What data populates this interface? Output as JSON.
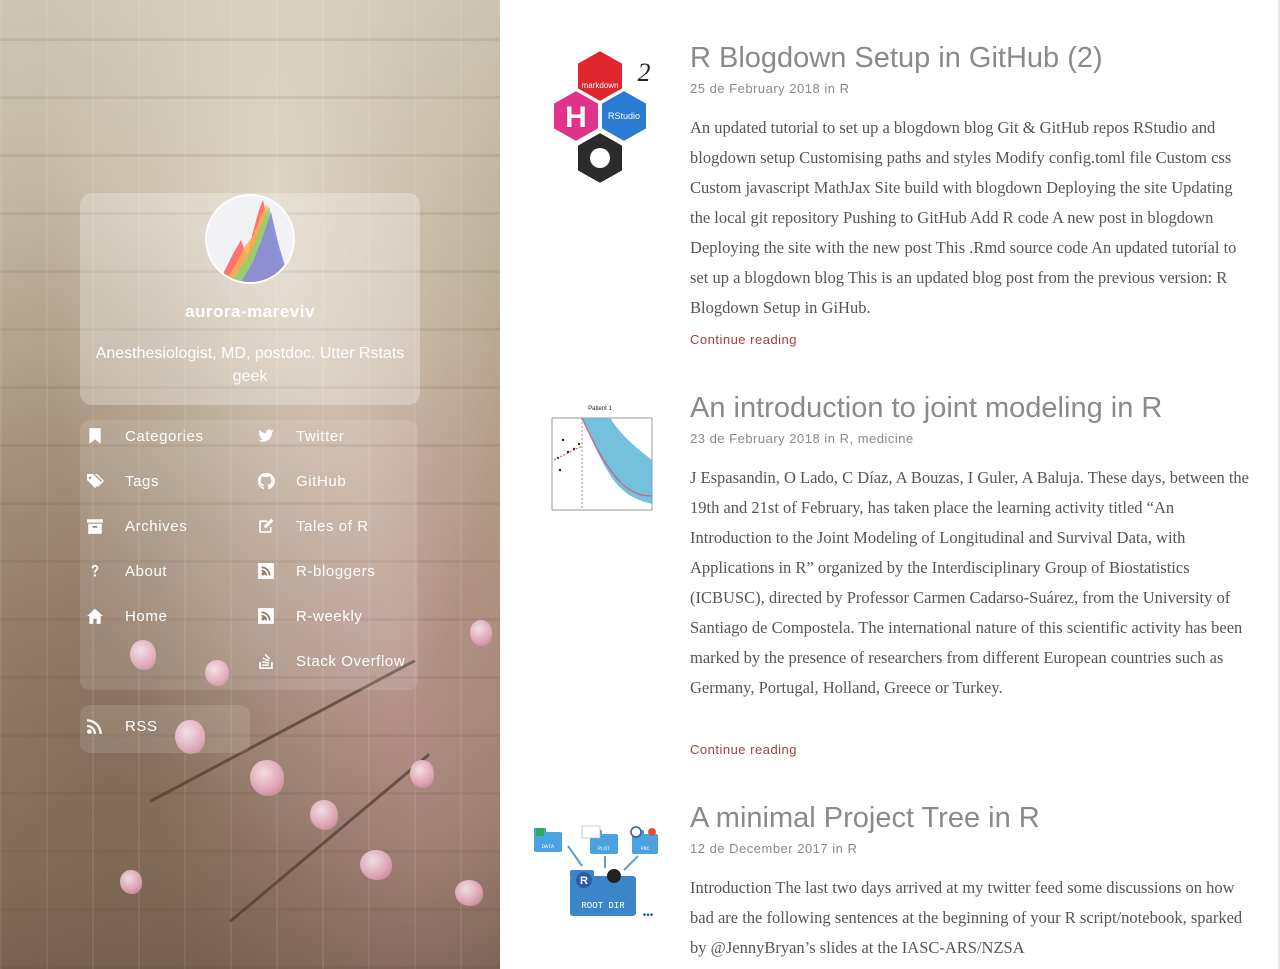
{
  "sidebar": {
    "site_name": "aurora-mareviv",
    "description": "Anesthesiologist, MD, postdoc. Utter Rstats geek",
    "menu_left": [
      {
        "label": "Categories",
        "icon": "bookmark-icon"
      },
      {
        "label": "Tags",
        "icon": "tags-icon"
      },
      {
        "label": "Archives",
        "icon": "archive-icon"
      },
      {
        "label": "About",
        "icon": "question-icon"
      },
      {
        "label": "Home",
        "icon": "home-icon"
      }
    ],
    "menu_right": [
      {
        "label": "Twitter",
        "icon": "twitter-icon"
      },
      {
        "label": "GitHub",
        "icon": "github-icon"
      },
      {
        "label": "Tales of R",
        "icon": "edit-icon"
      },
      {
        "label": "R-bloggers",
        "icon": "rss-square-icon"
      },
      {
        "label": "R-weekly",
        "icon": "rss-square-icon"
      },
      {
        "label": "Stack Overflow",
        "icon": "stack-overflow-icon"
      }
    ],
    "rss": {
      "label": "RSS",
      "icon": "rss-icon"
    }
  },
  "posts": [
    {
      "title": "R Blogdown Setup in GitHub (2)",
      "date": "25 de February 2018",
      "in_word": "in",
      "categories": [
        "R"
      ],
      "summary": "An updated tutorial to set up a blogdown blog Git & GitHub repos RStudio and blogdown setup Customising paths and styles Modify config.toml file Custom css Custom javascript MathJax Site build with blogdown Deploying the site Updating the local git repository Pushing to GitHub Add R code A new post in blogdown Deploying the site with the new post This .Rmd source code An updated tutorial to set up a blogdown blog This is an updated blog post from the previous version: R Blogdown Setup in GiHub.",
      "continue_label": "Continue reading",
      "thumb": {
        "badge_number": "2",
        "labels": [
          "markdown",
          "H",
          "RStudio"
        ]
      }
    },
    {
      "title": "An introduction to joint modeling in R",
      "date": "23 de February 2018",
      "in_word": "in",
      "categories": [
        "R",
        "medicine"
      ],
      "summary": "J Espasandin, O Lado, C Díaz, A Bouzas, I Guler, A Baluja. These days, between the 19th and 21st of February, has taken place the learning activity titled “An Introduction to the Joint Modeling of Longitudinal and Survival Data, with Applications in R” organized by the Interdisciplinary Group of Biostatistics (ICBUSC), directed by Professor Carmen Cadarso-Suárez, from the University of Santiago de Compostela. The international nature of this scientific activity has been marked by the presence of researchers from different European countries such as Germany, Portugal, Holland, Greece or Turkey.",
      "continue_label": "Continue reading",
      "thumb": {
        "chart_title": "Patient 1"
      }
    },
    {
      "title": "A minimal Project Tree in R",
      "date": "12 de December 2017",
      "in_word": "in",
      "categories": [
        "R"
      ],
      "summary": "Introduction The last two days arrived at my twitter feed some discussions on how bad are the following sentences at the beginning of your R script/notebook, sparked by @JennyBryan’s slides at the IASC-ARS/NZSA",
      "continue_label": "Continue reading",
      "thumb": {
        "folder_labels": [
          "DATA",
          "PLOT",
          "FNC"
        ],
        "root_label": "ROOT DIR",
        "root_icon_letter": "R",
        "ellipsis": "•••"
      }
    }
  ],
  "colors": {
    "link_red": "#a4403b",
    "title_gray": "#8a8a8a",
    "body_text": "#555555",
    "sidebar_text": "#ffffff"
  }
}
